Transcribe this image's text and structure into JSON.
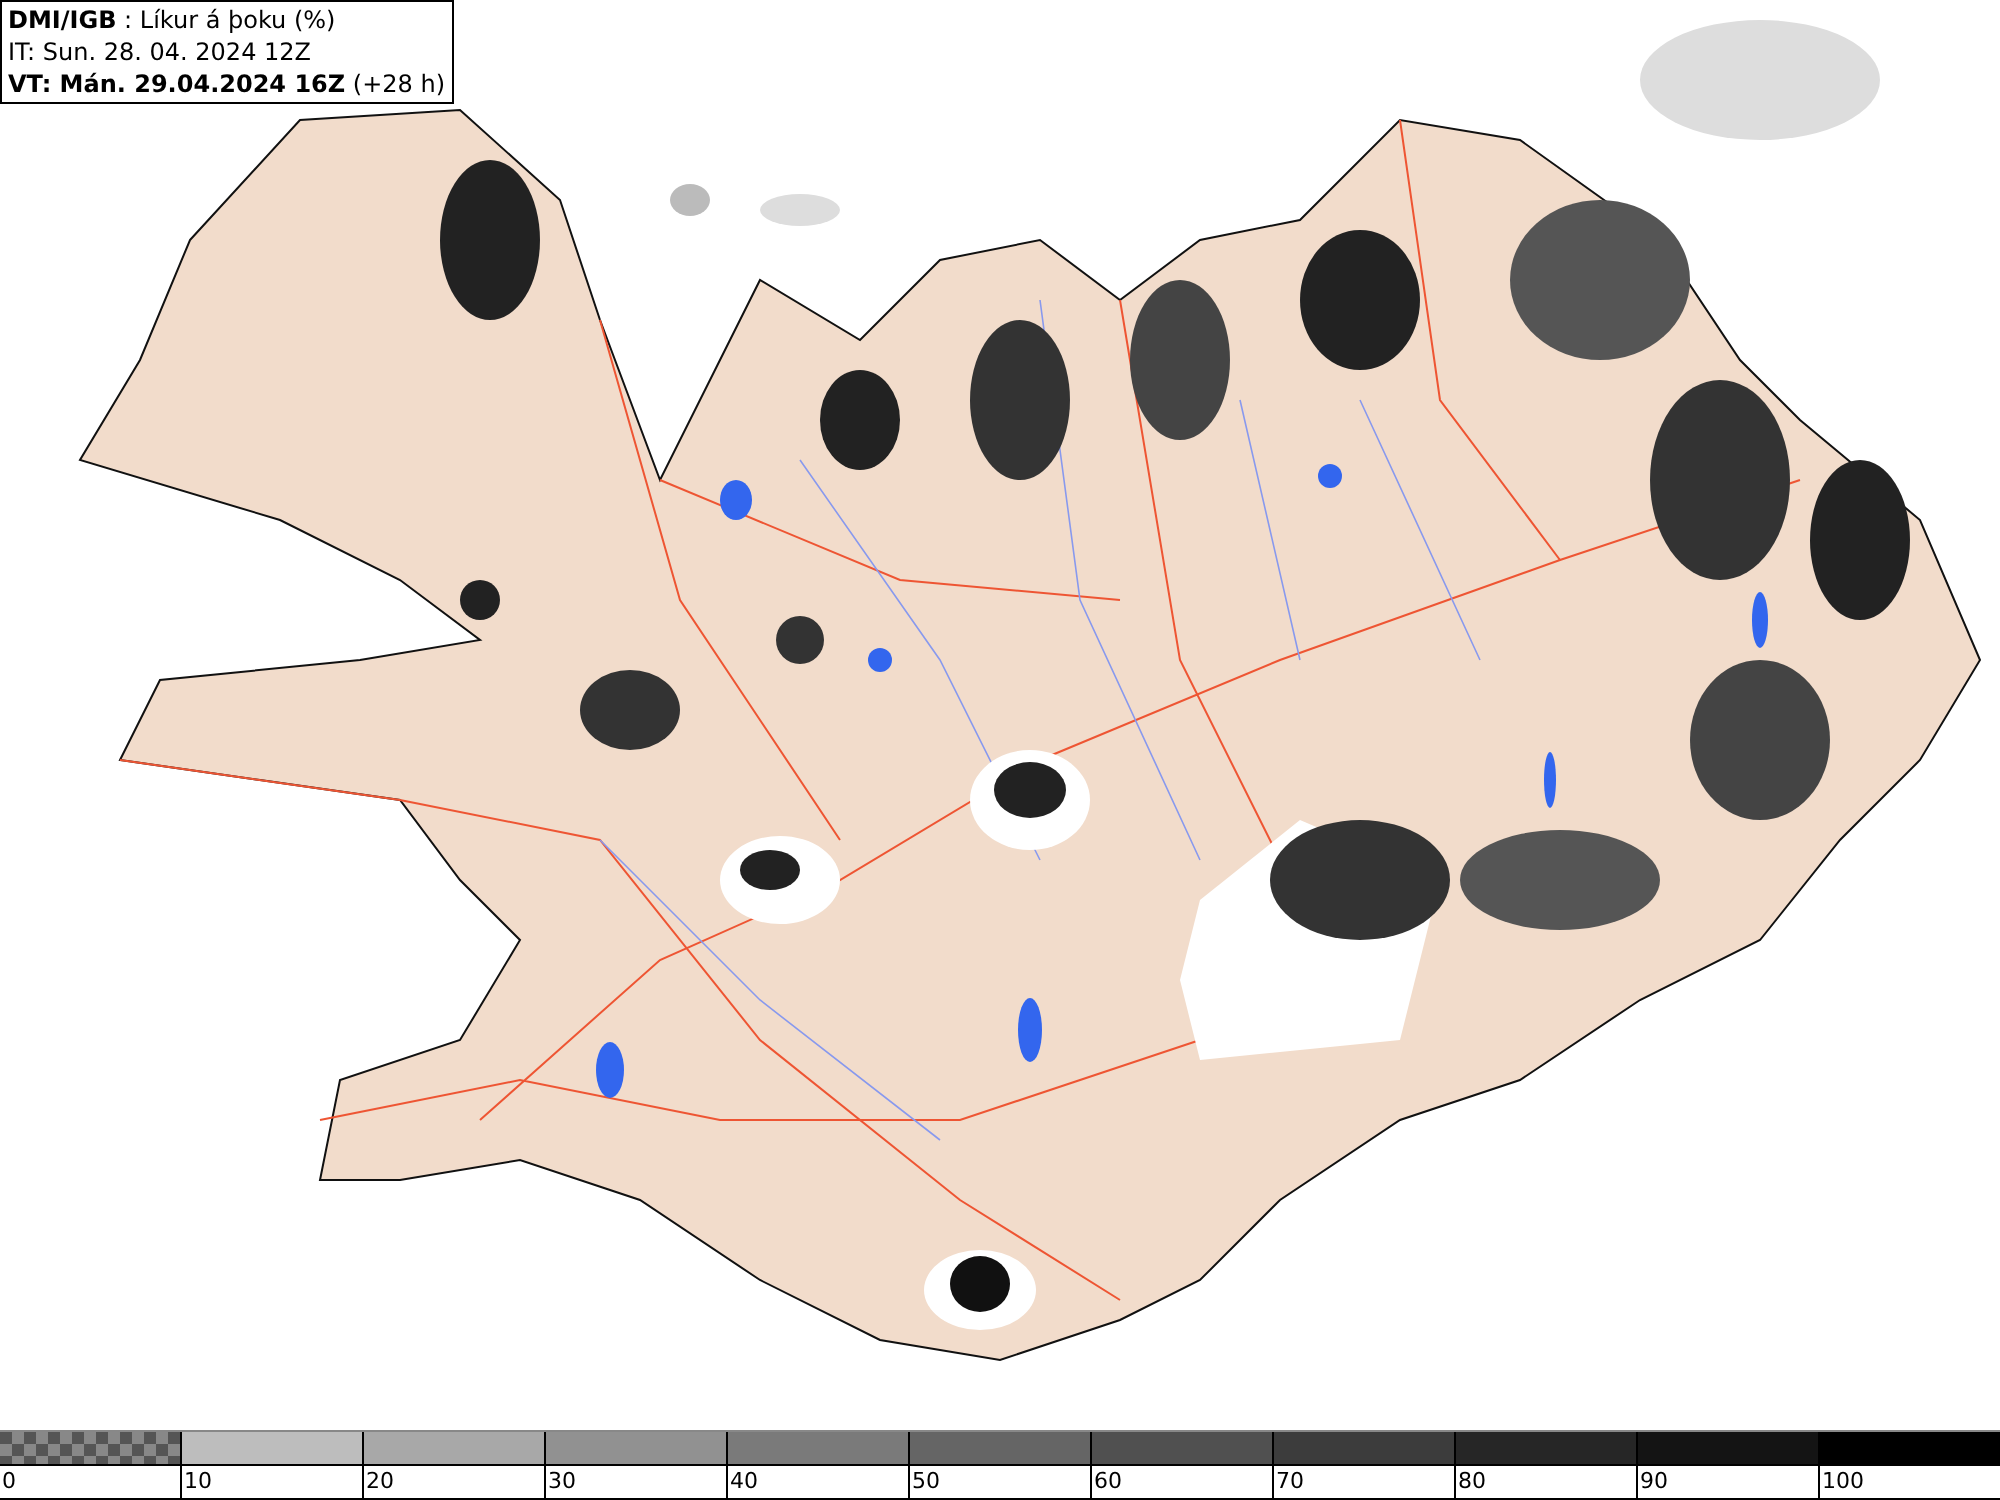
{
  "header": {
    "title": "**DMI/IGB** : Líkur á þoku (%)",
    "init_time": "IT: Sun. 28. 04. 2024 12Z",
    "valid_time": "**VT: Mán. 29.04.2024 16Z** (+28 h)"
  },
  "legend": [
    {
      "label": "0",
      "kind": "checker"
    },
    {
      "label": "10",
      "kind": "solid",
      "color": "#bdbdbd"
    },
    {
      "label": "20",
      "kind": "solid",
      "color": "#a8a8a8"
    },
    {
      "label": "30",
      "kind": "solid",
      "color": "#919191"
    },
    {
      "label": "40",
      "kind": "solid",
      "color": "#7a7a7a"
    },
    {
      "label": "50",
      "kind": "solid",
      "color": "#656565"
    },
    {
      "label": "60",
      "kind": "solid",
      "color": "#505050"
    },
    {
      "label": "70",
      "kind": "solid",
      "color": "#3c3c3c"
    },
    {
      "label": "80",
      "kind": "solid",
      "color": "#262626"
    },
    {
      "label": "90",
      "kind": "solid",
      "color": "#141414"
    },
    {
      "label": "100",
      "kind": "solid",
      "color": "#000000"
    }
  ]
}
